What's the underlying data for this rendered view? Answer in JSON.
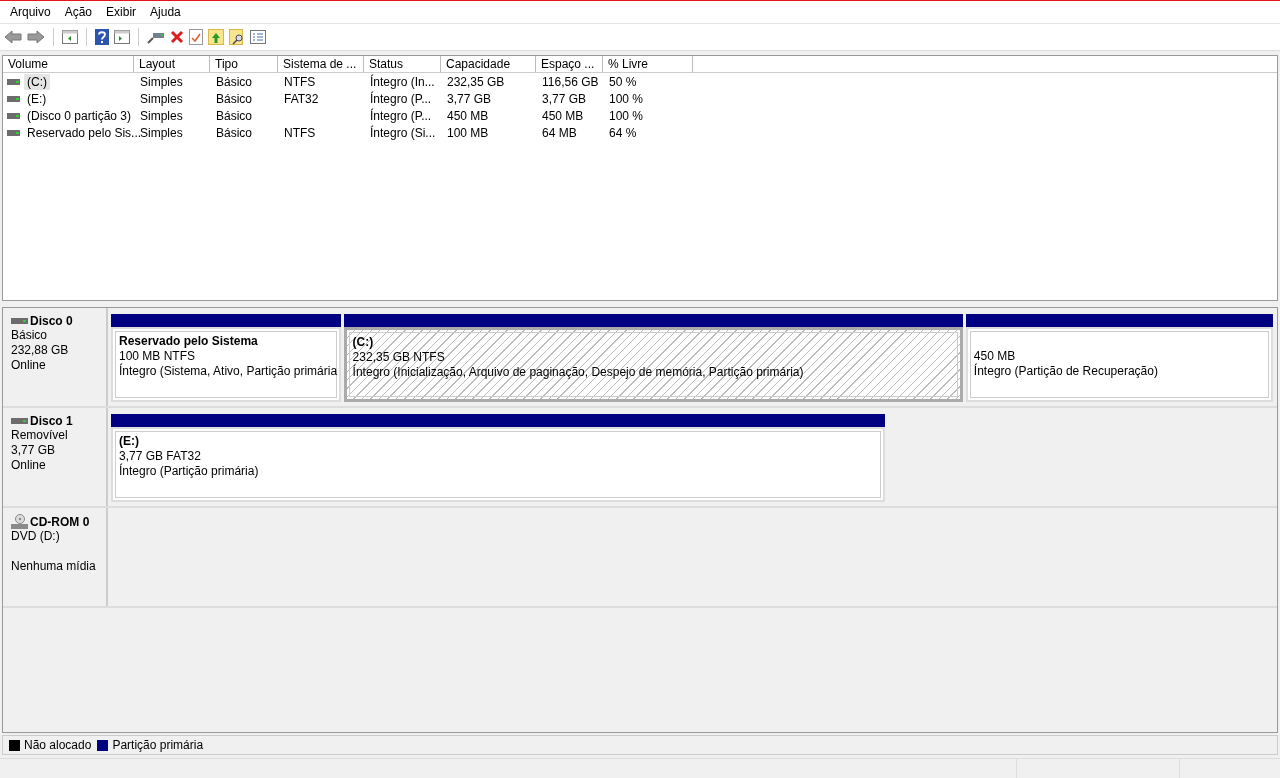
{
  "menu": [
    "Arquivo",
    "Ação",
    "Exibir",
    "Ajuda"
  ],
  "table": {
    "columns": [
      "Volume",
      "Layout",
      "Tipo",
      "Sistema de ...",
      "Status",
      "Capacidade",
      "Espaço ...",
      "% Livre"
    ],
    "rows": [
      {
        "selected": true,
        "cells": [
          "(C:)",
          "Simples",
          "Básico",
          "NTFS",
          "Íntegro (In...",
          "232,35 GB",
          "116,56 GB",
          "50 %"
        ]
      },
      {
        "selected": false,
        "cells": [
          "(E:)",
          "Simples",
          "Básico",
          "FAT32",
          "Íntegro (P...",
          "3,77 GB",
          "3,77 GB",
          "100 %"
        ]
      },
      {
        "selected": false,
        "cells": [
          "(Disco 0 partição 3)",
          "Simples",
          "Básico",
          "",
          "Íntegro (P...",
          "450 MB",
          "450 MB",
          "100 %"
        ]
      },
      {
        "selected": false,
        "cells": [
          "Reservado pelo Sis...",
          "Simples",
          "Básico",
          "NTFS",
          "Íntegro (Si...",
          "100 MB",
          "64 MB",
          "64 %"
        ]
      }
    ]
  },
  "disks": [
    {
      "kind": "disk",
      "name": "Disco 0",
      "lines": [
        "Básico",
        "232,88 GB",
        "Online"
      ],
      "partitions": [
        {
          "name": "Reservado pelo Sistema",
          "size": "100 MB NTFS",
          "status": "Íntegro (Sistema, Ativo, Partição primária",
          "selected": false
        },
        {
          "name": "(C:)",
          "size": "232,35 GB NTFS",
          "status": "Íntegro (Inicialização, Arquivo de paginação, Despejo de memória, Partição primária)",
          "selected": true
        },
        {
          "size": "450 MB",
          "status": "Íntegro (Partição de Recuperação)",
          "selected": false
        }
      ]
    },
    {
      "kind": "disk",
      "name": "Disco 1",
      "lines": [
        "Removível",
        "3,77 GB",
        "Online"
      ],
      "partitions": [
        {
          "name": "(E:)",
          "size": "3,77 GB FAT32",
          "status": "Íntegro (Partição primária)",
          "selected": false
        }
      ]
    },
    {
      "kind": "cdrom",
      "name": "CD-ROM 0",
      "lines": [
        "DVD (D:)",
        "Nenhuma mídia"
      ]
    }
  ],
  "legend": [
    {
      "label": "Não alocado",
      "color": "#000000"
    },
    {
      "label": "Partição primária",
      "color": "#000080"
    }
  ]
}
